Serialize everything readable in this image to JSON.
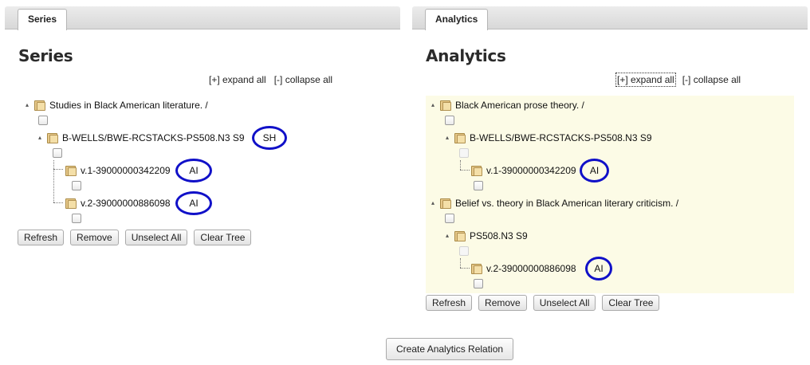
{
  "left": {
    "tab": "Series",
    "heading": "Series",
    "expand_all": "[+] expand all",
    "collapse_all": "[-] collapse all",
    "nodes": [
      {
        "label": "Studies in Black American literature. /"
      },
      {
        "label": "B-WELLS/BWE-RCSTACKS-PS508.N3 S9",
        "badge": "SH"
      },
      {
        "label": "v.1-39000000342209",
        "badge": "AI"
      },
      {
        "label": "v.2-39000000886098",
        "badge": "AI"
      }
    ],
    "buttons": {
      "refresh": "Refresh",
      "remove": "Remove",
      "unselect_all": "Unselect All",
      "clear_tree": "Clear Tree"
    }
  },
  "right": {
    "tab": "Analytics",
    "heading": "Analytics",
    "expand_all": "[+] expand all",
    "collapse_all": "[-] collapse all",
    "nodes": [
      {
        "label": "Black American prose theory. /"
      },
      {
        "label": "B-WELLS/BWE-RCSTACKS-PS508.N3 S9"
      },
      {
        "label": "v.1-39000000342209",
        "badge": "AI"
      },
      {
        "label": "Belief vs. theory in Black American literary criticism. /"
      },
      {
        "label": "PS508.N3 S9"
      },
      {
        "label": "v.2-39000000886098",
        "badge": "AI"
      }
    ],
    "buttons": {
      "refresh": "Refresh",
      "remove": "Remove",
      "unselect_all": "Unselect All",
      "clear_tree": "Clear Tree"
    }
  },
  "create_relation": "Create Analytics Relation",
  "colors": {
    "badge_ring": "#1010c8",
    "analytics_tree_bg": "#fcfbe6"
  },
  "icons": {
    "folder": "folder-icon",
    "toggle": "tree-toggle-icon"
  }
}
